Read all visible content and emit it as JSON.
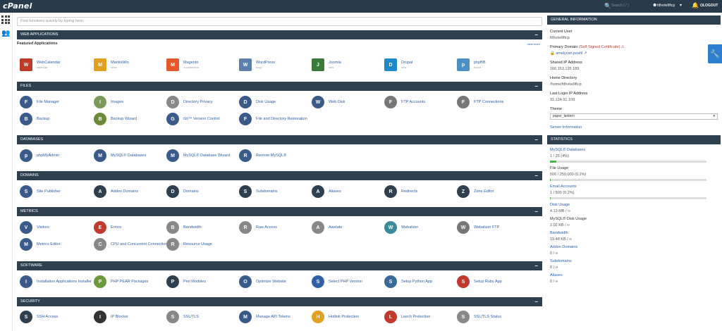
{
  "topbar": {
    "logo": "cPanel",
    "search_placeholder": "Search ( / )",
    "user": "fdhvtw9ftcp",
    "logout": "LOGOUT"
  },
  "find_placeholder": "Find functions quickly by typing here.",
  "colors": {
    "header": "#2e3f50",
    "topbar": "#293a4a",
    "link": "#2a5fa8",
    "accent": "#2f7fd1"
  },
  "sections": {
    "web_apps": {
      "title": "WEB APPLICATIONS",
      "featured": "Featured Applications",
      "view_more": "view more",
      "items": [
        {
          "label": "WebCalendar",
          "sub": "calendar",
          "icon": "calendar-icon",
          "color": "#c0392b"
        },
        {
          "label": "MantisWin",
          "sub": "other",
          "icon": "mantis-icon",
          "color": "#e0a020"
        },
        {
          "label": "Magento",
          "sub": "e-commerce",
          "icon": "magento-icon",
          "color": "#e8572a"
        },
        {
          "label": "WordPress",
          "sub": "blog",
          "icon": "wordpress-icon",
          "color": "#5a7fa8"
        },
        {
          "label": "Joomla",
          "sub": "cms",
          "icon": "joomla-icon",
          "color": "#3a7a3a"
        },
        {
          "label": "Drupal",
          "sub": "cms",
          "icon": "drupal-icon",
          "color": "#1f88c9"
        },
        {
          "label": "phpBB",
          "sub": "forum",
          "icon": "phpbb-icon",
          "color": "#4a90c2"
        }
      ]
    },
    "files": {
      "title": "FILES",
      "items": [
        {
          "label": "File Manager",
          "icon": "file-manager-icon",
          "color": "#3a5a8a"
        },
        {
          "label": "Images",
          "icon": "images-icon",
          "color": "#7a9a5a"
        },
        {
          "label": "Directory Privacy",
          "icon": "directory-privacy-icon",
          "color": "#888888"
        },
        {
          "label": "Disk Usage",
          "icon": "disk-usage-icon",
          "color": "#3a5a8a"
        },
        {
          "label": "Web Disk",
          "icon": "web-disk-icon",
          "color": "#3a5a8a"
        },
        {
          "label": "FTP Accounts",
          "icon": "ftp-accounts-icon",
          "color": "#777777"
        },
        {
          "label": "FTP Connections",
          "icon": "ftp-connections-icon",
          "color": "#777777"
        },
        {
          "label": "Backup",
          "icon": "backup-icon",
          "color": "#3a5a8a"
        },
        {
          "label": "Backup Wizard",
          "icon": "backup-wizard-icon",
          "color": "#6a8a3a"
        },
        {
          "label": "Git™ Version Control",
          "icon": "git-icon",
          "color": "#3a5a8a"
        },
        {
          "label": "File and Directory Restoration",
          "icon": "restore-icon",
          "color": "#3a5a8a"
        }
      ]
    },
    "databases": {
      "title": "DATABASES",
      "items": [
        {
          "label": "phpMyAdmin",
          "icon": "phpmyadmin-icon",
          "color": "#3a5a8a"
        },
        {
          "label": "MySQL® Databases",
          "icon": "mysql-databases-icon",
          "color": "#3a5a8a"
        },
        {
          "label": "MySQL® Database Wizard",
          "icon": "mysql-wizard-icon",
          "color": "#3a5a8a"
        },
        {
          "label": "Remote MySQL®",
          "icon": "remote-mysql-icon",
          "color": "#3a5a8a"
        }
      ]
    },
    "domains": {
      "title": "DOMAINS",
      "items": [
        {
          "label": "Site Publisher",
          "icon": "site-publisher-icon",
          "color": "#3a5a8a"
        },
        {
          "label": "Addon Domains",
          "icon": "addon-domains-icon",
          "color": "#2e3f50"
        },
        {
          "label": "Domains",
          "icon": "domains-icon",
          "color": "#2e3f50"
        },
        {
          "label": "Subdomains",
          "icon": "subdomains-icon",
          "color": "#2e3f50"
        },
        {
          "label": "Aliases",
          "icon": "aliases-icon",
          "color": "#2e3f50"
        },
        {
          "label": "Redirects",
          "icon": "redirects-icon",
          "color": "#2e3f50"
        },
        {
          "label": "Zone Editor",
          "icon": "zone-editor-icon",
          "color": "#2e3f50"
        }
      ]
    },
    "metrics": {
      "title": "METRICS",
      "items": [
        {
          "label": "Visitors",
          "icon": "visitors-icon",
          "color": "#3a5a8a"
        },
        {
          "label": "Errors",
          "icon": "errors-icon",
          "color": "#c0392b"
        },
        {
          "label": "Bandwidth",
          "icon": "bandwidth-icon",
          "color": "#888888"
        },
        {
          "label": "Raw Access",
          "icon": "raw-access-icon",
          "color": "#888888"
        },
        {
          "label": "Awstats",
          "icon": "awstats-icon",
          "color": "#888888"
        },
        {
          "label": "Webalizer",
          "icon": "webalizer-icon",
          "color": "#3a8a9a"
        },
        {
          "label": "Webalizer FTP",
          "icon": "webalizer-ftp-icon",
          "color": "#777777"
        },
        {
          "label": "Metrics Editor",
          "icon": "metrics-editor-icon",
          "color": "#3a5a8a"
        },
        {
          "label": "CPU and Concurrent Connection Usage",
          "icon": "cpu-usage-icon",
          "color": "#888888"
        },
        {
          "label": "Resource Usage",
          "icon": "resource-usage-icon",
          "color": "#888888"
        }
      ]
    },
    "software": {
      "title": "SOFTWARE",
      "items": [
        {
          "label": "Installation Applications Installer",
          "icon": "installer-icon",
          "color": "#3a5a8a"
        },
        {
          "label": "PHP PEAR Packages",
          "icon": "php-pear-icon",
          "color": "#6a9a3a"
        },
        {
          "label": "Perl Modules",
          "icon": "perl-modules-icon",
          "color": "#2e3f50"
        },
        {
          "label": "Optimize Website",
          "icon": "optimize-website-icon",
          "color": "#3a5a8a"
        },
        {
          "label": "Select PHP Version",
          "icon": "php-version-icon",
          "color": "#2e5fa8"
        },
        {
          "label": "Setup Python App",
          "icon": "python-icon",
          "color": "#3a6a9a"
        },
        {
          "label": "Setup Ruby App",
          "icon": "ruby-icon",
          "color": "#c0392b"
        }
      ]
    },
    "security": {
      "title": "SECURITY",
      "items": [
        {
          "label": "SSH Access",
          "icon": "ssh-access-icon",
          "color": "#2e3f50"
        },
        {
          "label": "IP Blocker",
          "icon": "ip-blocker-icon",
          "color": "#333333"
        },
        {
          "label": "SSL/TLS",
          "icon": "ssl-tls-icon",
          "color": "#888888"
        },
        {
          "label": "Manage API Tokens",
          "icon": "api-tokens-icon",
          "color": "#3a5a8a"
        },
        {
          "label": "Hotlink Protection",
          "icon": "hotlink-icon",
          "color": "#e0a020"
        },
        {
          "label": "Leech Protection",
          "icon": "leech-icon",
          "color": "#c0392b"
        },
        {
          "label": "SSL/TLS Status",
          "icon": "ssl-status-icon",
          "color": "#888888"
        }
      ]
    }
  },
  "general": {
    "title": "GENERAL INFORMATION",
    "current_user_label": "Current User",
    "current_user": "fdhvtw9ftcp",
    "primary_domain_label": "Primary Domain",
    "self_signed": "(Self-Signed Certificate)",
    "primary_domain": "smelycan.poshl",
    "shared_ip_label": "Shared IP Address",
    "shared_ip": "166.153.135.189",
    "home_dir_label": "Home Directory",
    "home_dir": "/home/fdhvtw9ftcp",
    "last_login_label": "Last Login IP Address",
    "last_login": "31.124.91.109",
    "theme_label": "Theme",
    "theme": "paper_lantern",
    "server_info": "Server Information"
  },
  "statistics": {
    "title": "STATISTICS",
    "items": [
      {
        "name": "MySQL® Databases",
        "value": "1 / 25   (4%)",
        "percent": 4,
        "link": true,
        "bar": true
      },
      {
        "name": "File Usage",
        "value": "506 / 250,000   (0.2%)",
        "percent": 0.2,
        "link": false,
        "bar": true
      },
      {
        "name": "Email Accounts",
        "value": "1 / 500   (0.2%)",
        "percent": 0.2,
        "link": true,
        "bar": true
      },
      {
        "name": "Disk Usage",
        "value": "4.13 MB / ∞",
        "link": true,
        "bar": false
      },
      {
        "name": "MySQL® Disk Usage",
        "value": "2.02 KB / ∞",
        "link": false,
        "bar": false
      },
      {
        "name": "Bandwidth",
        "value": "19.48 KB / ∞",
        "link": true,
        "bar": false
      },
      {
        "name": "Addon Domains",
        "value": "0 / ∞",
        "link": true,
        "bar": false
      },
      {
        "name": "Subdomains",
        "value": "0 / ∞",
        "link": true,
        "bar": false
      },
      {
        "name": "Aliases",
        "value": "0 / ∞",
        "link": true,
        "bar": false
      }
    ]
  }
}
